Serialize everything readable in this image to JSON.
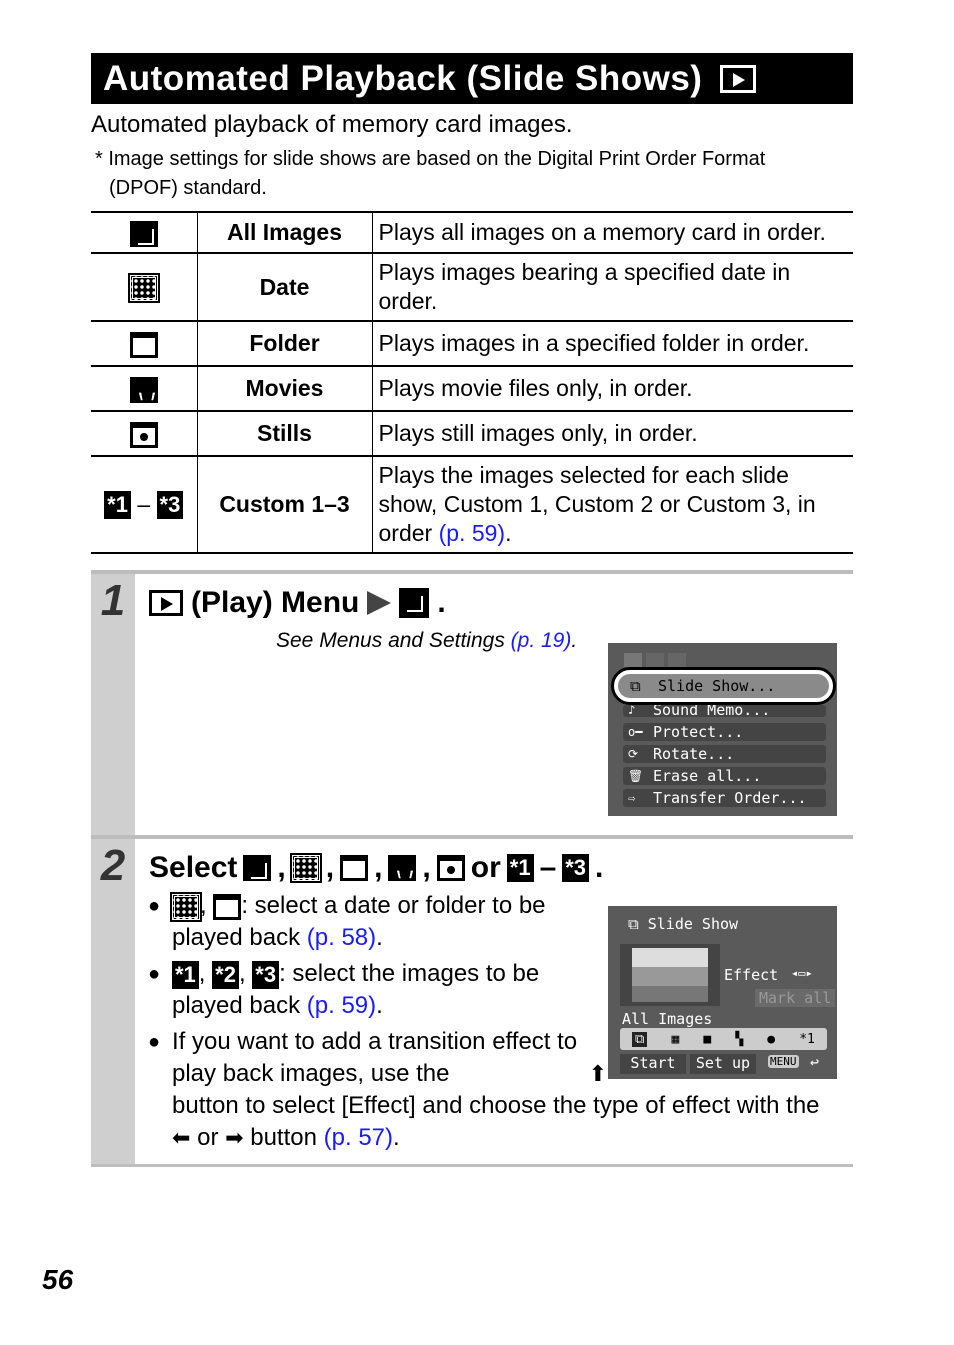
{
  "title": "Automated Playback (Slide Shows)",
  "intro": "Automated playback of memory card images.",
  "note_line1": "* Image settings for slide shows are based on the Digital Print Order Format",
  "note_line2": "(DPOF) standard.",
  "table": [
    {
      "icon": "all-images-icon",
      "name": "All Images",
      "desc": "Plays all images on a memory card in order."
    },
    {
      "icon": "date-calendar-icon",
      "name": "Date",
      "desc": "Plays images bearing a specified date in order."
    },
    {
      "icon": "folder-icon",
      "name": "Folder",
      "desc": "Plays images in a specified folder in order."
    },
    {
      "icon": "movie-icon",
      "name": "Movies",
      "desc": "Plays movie files only, in order."
    },
    {
      "icon": "camera-still-icon",
      "name": "Stills",
      "desc": "Plays still images only, in order."
    },
    {
      "icon": "custom-icon",
      "name": "Custom 1–3",
      "desc": "Plays the images selected for each slide show, Custom 1, Custom 2 or Custom 3, in order ",
      "link": "(p. 59)",
      "end": "."
    }
  ],
  "custom_icons": {
    "c1": "*1",
    "c2": "*2",
    "c3": "*3",
    "dash": "–"
  },
  "step1": {
    "number": "1",
    "heading": "(Play) Menu",
    "see": "See Menus and Settings ",
    "see_link": "(p. 19)",
    "period": ".",
    "menu_screen": {
      "tabs": [
        "play",
        "print",
        "setup"
      ],
      "items": [
        "Slide Show...",
        "Sound Memo...",
        "Protect...",
        "Rotate...",
        "Erase all...",
        "Transfer Order..."
      ]
    }
  },
  "step2": {
    "number": "2",
    "heading_select": "Select",
    "heading_or": "or",
    "bullet1_text": ": select a date or folder to be played back ",
    "bullet1_link": "(p. 58)",
    "bullet2_text": ": select the images to be played back ",
    "bullet2_link": "(p. 59)",
    "bullet3_a": "If you want to add a transition effect to play back images, use the",
    "bullet3_b": "button to select [Effect] and choose the type of effect with the",
    "bullet3_or": "or",
    "bullet3_c": "button ",
    "bullet3_link": "(p. 57)",
    "period": ".",
    "screen": {
      "title": "Slide Show",
      "effect": "Effect",
      "mark_all": "Mark all",
      "mode": "All Images",
      "custom": "*1",
      "start": "Start",
      "setup": "Set up",
      "menu": "MENU"
    }
  },
  "page_number": "56",
  "colors": {
    "link": "#1a1aff",
    "step_bar": "#cfcfcf",
    "screen_bg": "#5a5a5a"
  }
}
